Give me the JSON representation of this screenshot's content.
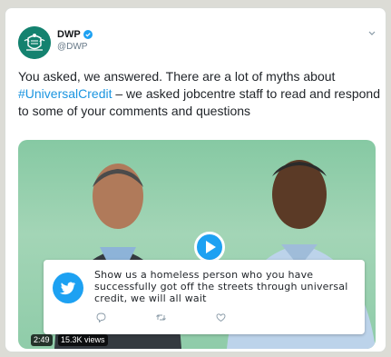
{
  "tweet": {
    "author": {
      "display_name": "DWP",
      "handle": "@DWP",
      "verified": true
    },
    "text_before": "You asked, we answered. There are a lot of myths about ",
    "hashtag": "#UniversalCredit",
    "text_after": " – we asked jobcentre staff to read and respond to some of your comments and questions"
  },
  "media": {
    "quote_text": "Show us a homeless person who you have successfully got off the streets through universal credit, we will all wait",
    "duration": "2:49",
    "views": "15.3K views"
  },
  "colors": {
    "avatar_bg": "#14826f",
    "link": "#1b95e0",
    "brand_blue": "#1da1f2",
    "media_bg": "#8fcca9"
  },
  "icons": {
    "avatar": "dwp-crest-icon",
    "verified": "verified-badge-icon",
    "menu": "chevron-down-icon",
    "play": "play-icon",
    "quote_logo": "twitter-bird-icon",
    "reply": "reply-icon",
    "retweet": "retweet-icon",
    "like": "heart-icon"
  }
}
